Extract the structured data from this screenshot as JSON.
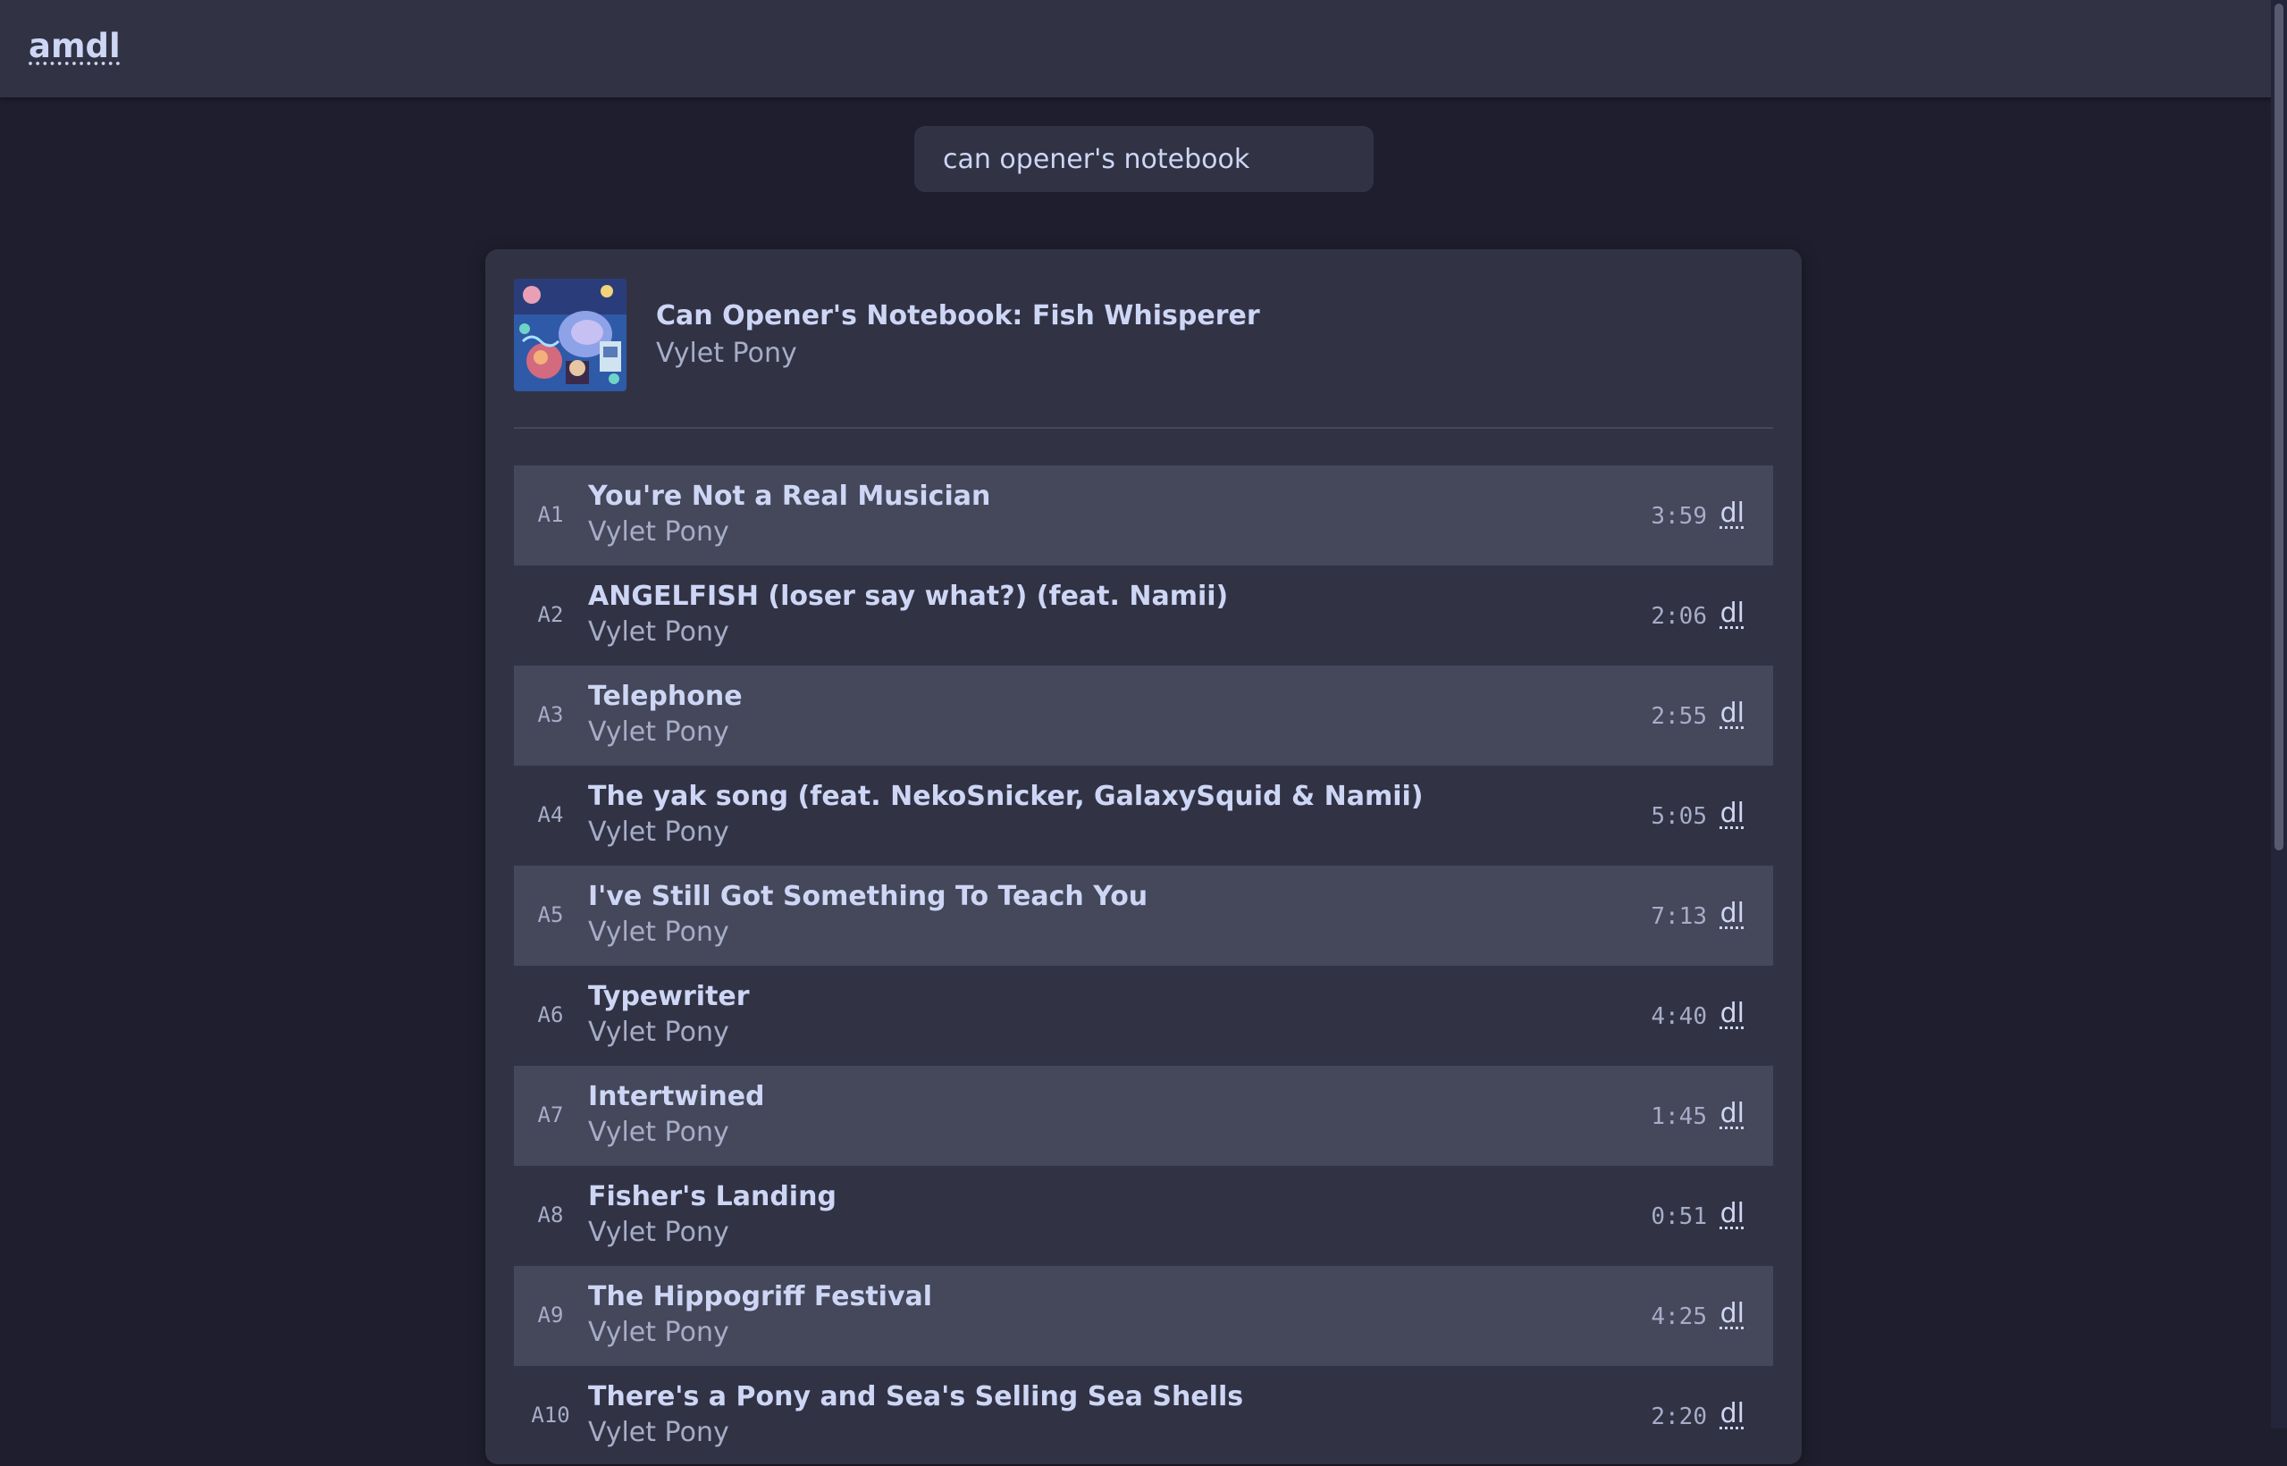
{
  "app": {
    "logo": "amdl"
  },
  "search": {
    "value": "can opener's notebook",
    "placeholder": ""
  },
  "album": {
    "title": "Can Opener's Notebook: Fish Whisperer",
    "artist": "Vylet Pony",
    "cover_icon": "album-art"
  },
  "tracks": [
    {
      "num": "A1",
      "title": "You're Not a Real Musician",
      "artist": "Vylet Pony",
      "duration": "3:59",
      "dl": "dl"
    },
    {
      "num": "A2",
      "title": "ANGELFISH (loser say what?) (feat. Namii)",
      "artist": "Vylet Pony",
      "duration": "2:06",
      "dl": "dl"
    },
    {
      "num": "A3",
      "title": "Telephone",
      "artist": "Vylet Pony",
      "duration": "2:55",
      "dl": "dl"
    },
    {
      "num": "A4",
      "title": "The yak song (feat. NekoSnicker, GalaxySquid & Namii)",
      "artist": "Vylet Pony",
      "duration": "5:05",
      "dl": "dl"
    },
    {
      "num": "A5",
      "title": "I've Still Got Something To Teach You",
      "artist": "Vylet Pony",
      "duration": "7:13",
      "dl": "dl"
    },
    {
      "num": "A6",
      "title": "Typewriter",
      "artist": "Vylet Pony",
      "duration": "4:40",
      "dl": "dl"
    },
    {
      "num": "A7",
      "title": "Intertwined",
      "artist": "Vylet Pony",
      "duration": "1:45",
      "dl": "dl"
    },
    {
      "num": "A8",
      "title": "Fisher's Landing",
      "artist": "Vylet Pony",
      "duration": "0:51",
      "dl": "dl"
    },
    {
      "num": "A9",
      "title": "The Hippogriff Festival",
      "artist": "Vylet Pony",
      "duration": "4:25",
      "dl": "dl"
    },
    {
      "num": "A10",
      "title": "There's a Pony and Sea's Selling Sea Shells",
      "artist": "Vylet Pony",
      "duration": "2:20",
      "dl": "dl"
    }
  ],
  "colors": {
    "background": "#1e1e2e",
    "surface": "#313244",
    "row_alt": "#45475a",
    "text": "#cdd6f4",
    "subtext": "#a6adc8"
  }
}
